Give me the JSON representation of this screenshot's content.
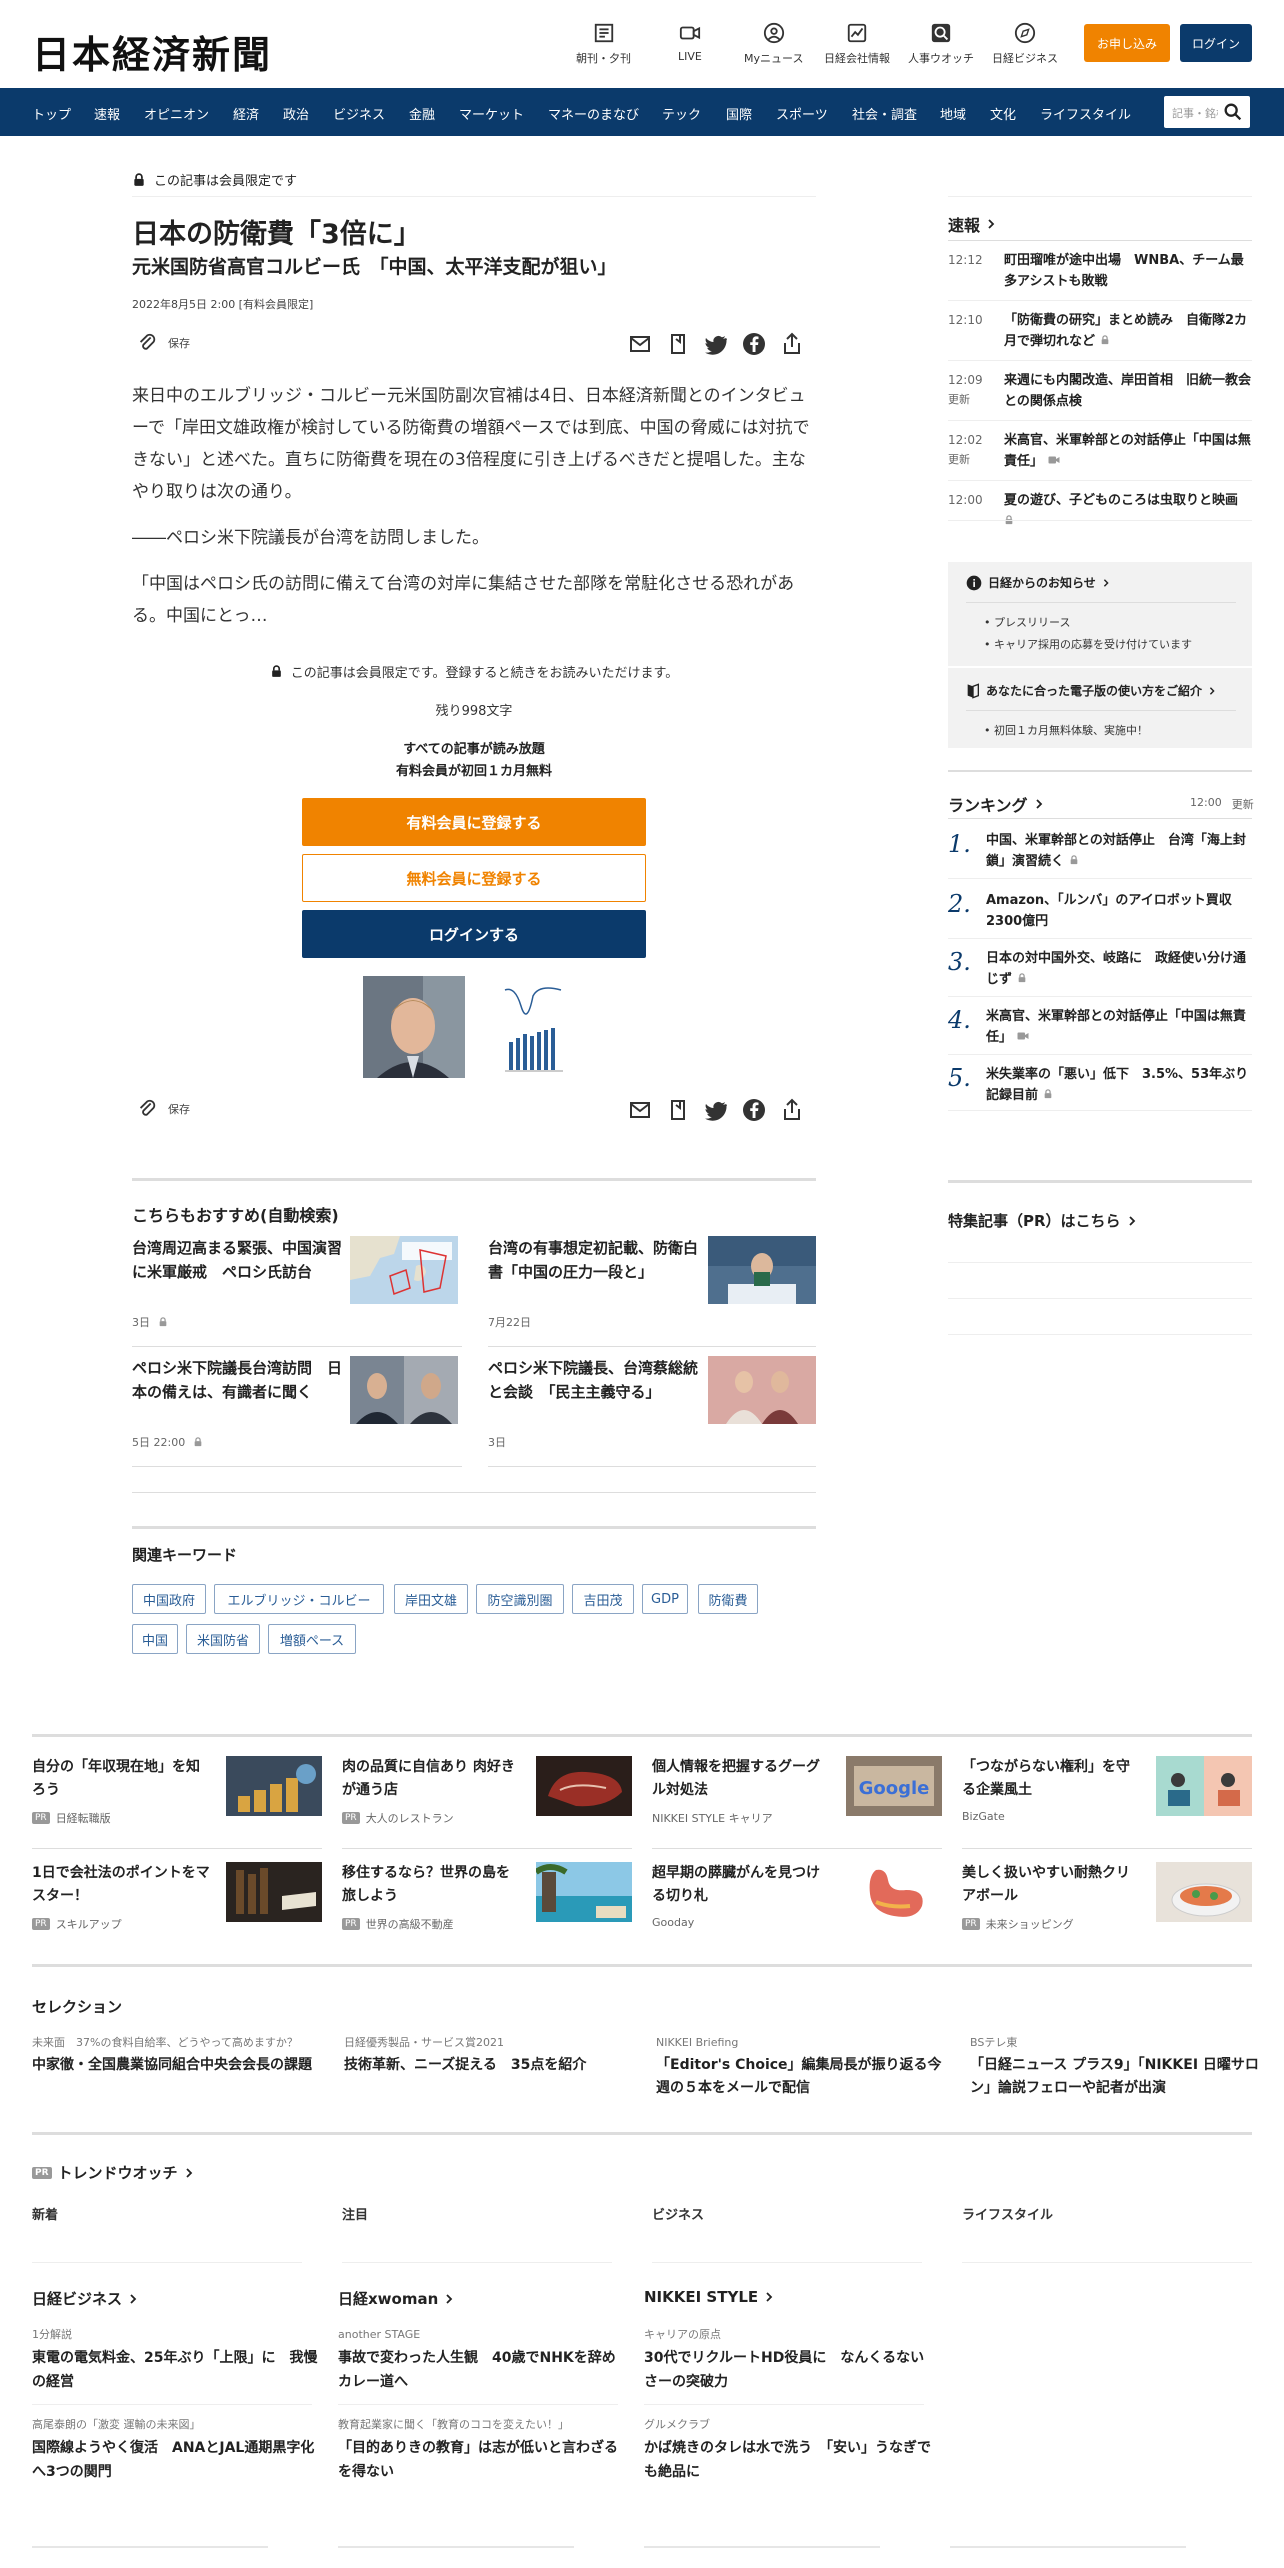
{
  "header": {
    "logo": "日本経済新聞",
    "nav": [
      "朝刊・夕刊",
      "LIVE",
      "Myニュース",
      "日経会社情報",
      "人事ウオッチ",
      "日経ビジネス"
    ],
    "apply": "お申し込み",
    "login": "ログイン"
  },
  "menu": {
    "items": [
      "トップ",
      "速報",
      "オピニオン",
      "経済",
      "政治",
      "ビジネス",
      "金融",
      "マーケット",
      "マネーのまなび",
      "テック",
      "国際",
      "スポーツ",
      "社会・調査",
      "地域",
      "文化",
      "ライフスタイル"
    ],
    "search_placeholder": "記事・銘柄"
  },
  "article": {
    "member_badge": "この記事は会員限定です",
    "title": "日本の防衛費「3倍に」",
    "subtitle": "元米国防省高官コルビー氏　「中国、太平洋支配が狙い」",
    "date": "2022年8月5日 2:00 [有料会員限定]",
    "save": "保存",
    "paragraphs": [
      "来日中のエルブリッジ・コルビー元米国防副次官補は4日、日本経済新聞とのインタビューで「岸田文雄政権が検討している防衛費の増額ペースでは到底、中国の脅威には対抗できない」と述べた。直ちに防衛費を現在の3倍程度に引き上げるべきだと提唱した。主なやり取りは次の通り。",
      "――ペロシ米下院議長が台湾を訪問しました。",
      "「中国はペロシ氏の訪問に備えて台湾の対岸に集結させた部隊を常駐化させる恐れがある。中国にとっ…"
    ],
    "paywall_note": "この記事は会員限定です。登録すると続きをお読みいただけます。",
    "remaining": "残り998文字",
    "offer_line1": "すべての記事が読み放題",
    "offer_line2": "有料会員が初回１カ月無料",
    "cta_paid": "有料会員に登録する",
    "cta_free": "無料会員に登録する",
    "cta_login": "ログインする"
  },
  "recommend": {
    "heading": "こちらもおすすめ(自動検索)",
    "items": [
      {
        "title": "台湾周辺高まる緊張、中国演習に米軍厳戒　ペロシ氏訪台",
        "meta": "3日"
      },
      {
        "title": "台湾の有事想定初記載、防衛白書「中国の圧力一段と」",
        "meta": "7月22日"
      },
      {
        "title": "ペロシ米下院議長台湾訪問　日本の備えは、有識者に聞く",
        "meta": "5日 22:00"
      },
      {
        "title": "ペロシ米下院議長、台湾蔡総統と会談　「民主主義守る」",
        "meta": "3日"
      }
    ]
  },
  "keywords": {
    "heading": "関連キーワード",
    "items": [
      "中国政府",
      "エルブリッジ・コルビー",
      "岸田文雄",
      "防空識別圏",
      "吉田茂",
      "GDP",
      "防衛費",
      "中国",
      "米国防省",
      "増額ペース"
    ]
  },
  "sidebar": {
    "flash_heading": "速報",
    "flash": [
      {
        "time": "12:12",
        "note": "",
        "title": "町田瑠唯が途中出場　WNBA、チーム最多アシストも敗戦"
      },
      {
        "time": "12:10",
        "note": "",
        "title": "「防衛費の研究」まとめ読み　自衛隊2カ月で弾切れなど"
      },
      {
        "time": "12:09",
        "note": "更新",
        "title": "来週にも内閣改造、岸田首相　旧統一教会との関係点検"
      },
      {
        "time": "12:02",
        "note": "更新",
        "title": "米高官、米軍幹部との対話停止「中国は無責任」"
      },
      {
        "time": "12:00",
        "note": "",
        "title": "夏の遊び、子どものころは虫取りと映画"
      }
    ],
    "notice_heading": "日経からのお知らせ",
    "notices": [
      "プレスリリース",
      "キャリア採用の応募を受け付けています"
    ],
    "digital_heading": "あなたに合った電子版の使い方をご紹介",
    "digital": [
      "初回１カ月無料体験、実施中！"
    ],
    "ranking_heading": "ランキング",
    "ranking_time": "12:00",
    "ranking_update": "更新",
    "ranking": [
      "中国、米軍幹部との対話停止　台湾「海上封鎖」演習続く",
      "Amazon、「ルンバ」のアイロボット買収　2300億円",
      "日本の対中国外交、岐路に　政経使い分け通じず",
      "米高官、米軍幹部との対話停止「中国は無責任」",
      "米失業率の「悪い」低下　3.5%、53年ぶり記録目前"
    ],
    "pr_heading": "特集記事（PR）はこちら"
  },
  "pr": {
    "items": [
      {
        "title": "自分の「年収現在地」を知ろう",
        "source": "日経転職版"
      },
      {
        "title": "肉の品質に自信あり 肉好きが通う店",
        "source": "大人のレストラン"
      },
      {
        "title": "個人情報を把握するグーグル対処法",
        "source": "NIKKEI STYLE キャリア"
      },
      {
        "title": "「つながらない権利」を守る企業風土",
        "source": "BizGate"
      },
      {
        "title": "1日で会社法のポイントをマスター！",
        "source": "スキルアップ"
      },
      {
        "title": "移住するなら？世界の島を旅しよう",
        "source": "世界の高級不動産"
      },
      {
        "title": "超早期の膵臓がんを見つける切り札",
        "source": "Gooday"
      },
      {
        "title": "美しく扱いやすい耐熱クリアボール",
        "source": "未来ショッピング"
      }
    ],
    "badge": "PR",
    "google_text": "Google"
  },
  "selection": {
    "heading": "セレクション",
    "items": [
      {
        "sub": "未来面　37%の食料自給率、どうやって高めますか？",
        "title": "中家徹・全国農業協同組合中央会会長の課題"
      },
      {
        "sub": "日経優秀製品・サービス賞2021",
        "title": "技術革新、ニーズ捉える　35点を紹介"
      },
      {
        "sub": "NIKKEI Briefing",
        "title": "「Editor's Choice」編集局長が振り返る今週の５本をメールで配信"
      },
      {
        "sub": "BSテレ東",
        "title": "「日経ニュース プラス9」「NIKKEI 日曜サロン」論説フェローや記者が出演"
      }
    ]
  },
  "trend": {
    "heading": "トレンドウオッチ",
    "tabs": [
      "新着",
      "注目",
      "ビジネス",
      "ライフスタイル"
    ]
  },
  "brands": [
    {
      "name": "日経ビジネス",
      "items": [
        {
          "sub": "1分解説",
          "title": "東電の電気料金、25年ぶり「上限」に　我慢の経営"
        },
        {
          "sub": "高尾泰朗の「激変 運輸の未来図」",
          "title": "国際線ようやく復活　ANAとJAL通期黒字化へ3つの関門"
        }
      ]
    },
    {
      "name": "日経xwoman",
      "items": [
        {
          "sub": "another STAGE",
          "title": "事故で変わった人生観　40歳でNHKを辞めカレー道へ"
        },
        {
          "sub": "教育起業家に聞く「教育のココを変えたい！」",
          "title": "「目的ありきの教育」は志が低いと言わざるを得ない"
        }
      ]
    },
    {
      "name": "NIKKEI STYLE",
      "items": [
        {
          "sub": "キャリアの原点",
          "title": "30代でリクルートHD役員に　なんくるないさーの突破力"
        },
        {
          "sub": "グルメクラブ",
          "title": "かば焼きのタレは水で洗う　「安い」うなぎでも絶品に"
        }
      ]
    }
  ],
  "colors": {
    "navy": "#0b3a6b",
    "orange": "#f08300"
  }
}
